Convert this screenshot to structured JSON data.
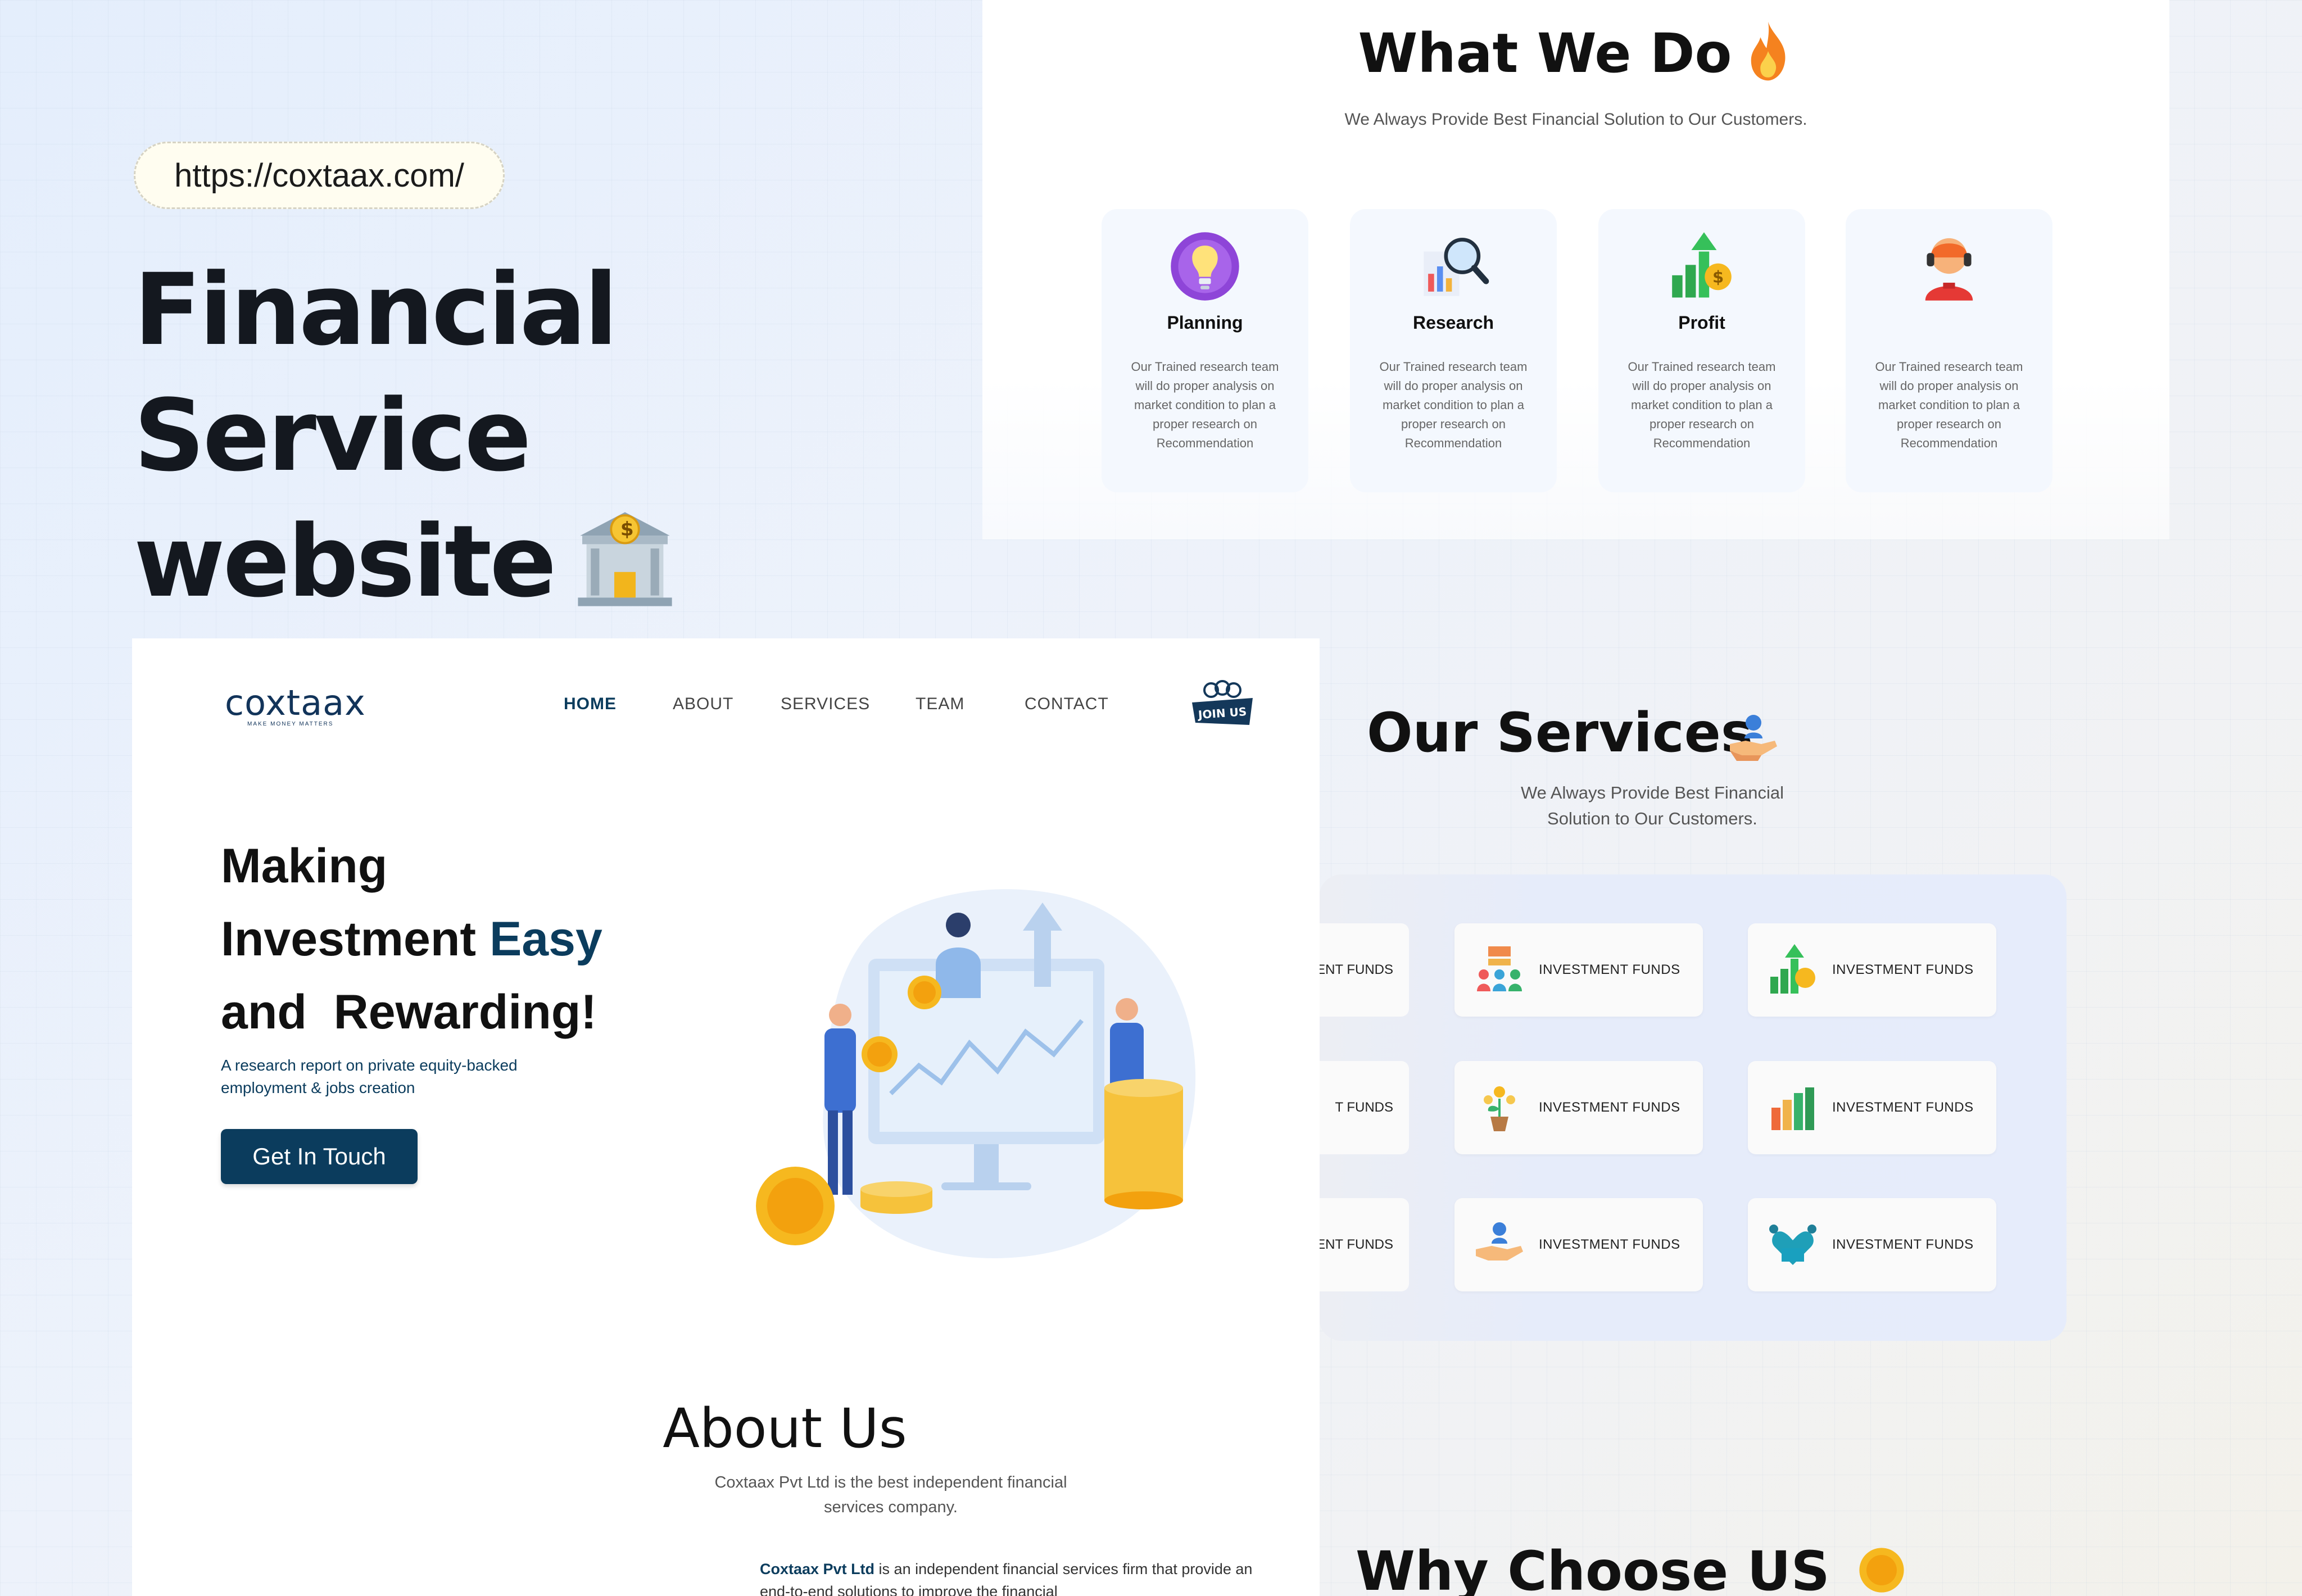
{
  "promo": {
    "url": "https://coxtaax.com/",
    "title_line1": "Financial Service",
    "title_line2": "website"
  },
  "what_we_do": {
    "title": "What We Do",
    "subtitle": "We Always Provide Best Financial Solution to Our Customers.",
    "cards": [
      {
        "title": "Planning",
        "icon": "lightbulb-icon",
        "desc": "Our Trained research team will do proper analysis on market condition to plan a proper research on Recommendation"
      },
      {
        "title": "Research",
        "icon": "magnifier-chart-icon",
        "desc": "Our Trained research team will do proper analysis on market condition to plan a proper research on Recommendation"
      },
      {
        "title": "Profit",
        "icon": "growth-chart-icon",
        "desc": "Our Trained research team will do proper analysis on market condition to plan a proper research on Recommendation"
      },
      {
        "title": "",
        "icon": "support-agent-icon",
        "desc": "Our Trained research team will do proper analysis on market condition to plan a proper research on Recommendation"
      }
    ]
  },
  "services": {
    "title": "Our Services",
    "subtitle_line1": "We Always Provide Best Financial",
    "subtitle_line2": "Solution to Our Customers.",
    "partial_cards": [
      "ENT FUNDS",
      "T FUNDS",
      "ENT FUNDS"
    ],
    "cards": [
      {
        "label": "INVESTMENT FUNDS",
        "icon": "team-hierarchy-icon"
      },
      {
        "label": "INVESTMENT FUNDS",
        "icon": "growth-chart-icon"
      },
      {
        "label": "INVESTMENT FUNDS",
        "icon": "money-plant-icon"
      },
      {
        "label": "INVESTMENT FUNDS",
        "icon": "bar-chart-icon"
      },
      {
        "label": "INVESTMENT FUNDS",
        "icon": "hand-person-icon"
      },
      {
        "label": "INVESTMENT FUNDS",
        "icon": "heart-team-icon"
      }
    ]
  },
  "why": {
    "title": "Why Choose US"
  },
  "site": {
    "logo": "coxtaax",
    "logo_tagline": "MAKE MONEY MATTERS",
    "nav": [
      "HOME",
      "ABOUT",
      "SERVICES",
      "TEAM",
      "CONTACT"
    ],
    "join_label": "JOIN US",
    "hero_line1": "Making",
    "hero_line2a": "Investment",
    "hero_line2b": "Easy",
    "hero_line3": "and  Rewarding!",
    "hero_sub": "A research report on private equity-backed employment & jobs creation",
    "cta": "Get In Touch",
    "about_title": "About Us",
    "about_sub": "Coxtaax Pvt Ltd is the best independent financial services company.",
    "about_strong": "Coxtaax Pvt Ltd",
    "about_text": " is an independent financial services firm that provide an end-to-end solutions to improve the financial"
  }
}
